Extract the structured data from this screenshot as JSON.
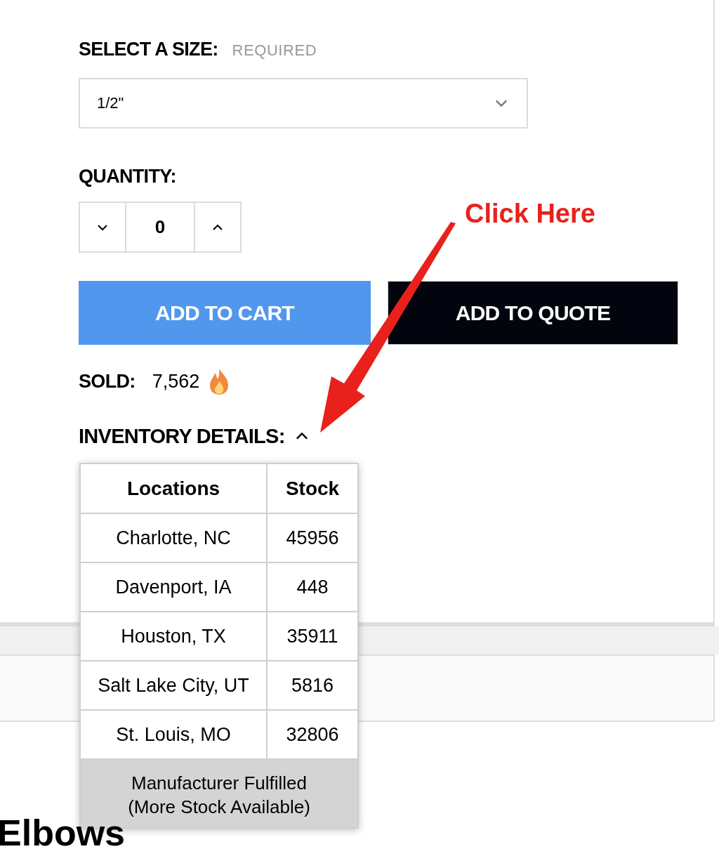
{
  "size_selector": {
    "label": "SELECT A SIZE:",
    "required_note": "REQUIRED",
    "value": "1/2\""
  },
  "quantity": {
    "label": "QUANTITY:",
    "value": "0"
  },
  "buttons": [
    {
      "label": "ADD TO CART",
      "kind": "primary"
    },
    {
      "label": "ADD TO QUOTE",
      "kind": "dark"
    }
  ],
  "sold": {
    "label": "SOLD:",
    "value": "7,562"
  },
  "inventory": {
    "label": "INVENTORY DETAILS:",
    "expanded": true,
    "columns": [
      "Locations",
      "Stock"
    ],
    "rows": [
      {
        "location": "Charlotte, NC",
        "stock": "45956"
      },
      {
        "location": "Davenport, IA",
        "stock": "448"
      },
      {
        "location": "Houston, TX",
        "stock": "35911"
      },
      {
        "location": "Salt Lake City, UT",
        "stock": "5816"
      },
      {
        "location": "St. Louis, MO",
        "stock": "32806"
      }
    ],
    "footer": [
      "Manufacturer Fulfilled",
      "(More Stock Available)"
    ]
  },
  "heading": "Elbows",
  "annotation": {
    "text": "Click Here"
  }
}
